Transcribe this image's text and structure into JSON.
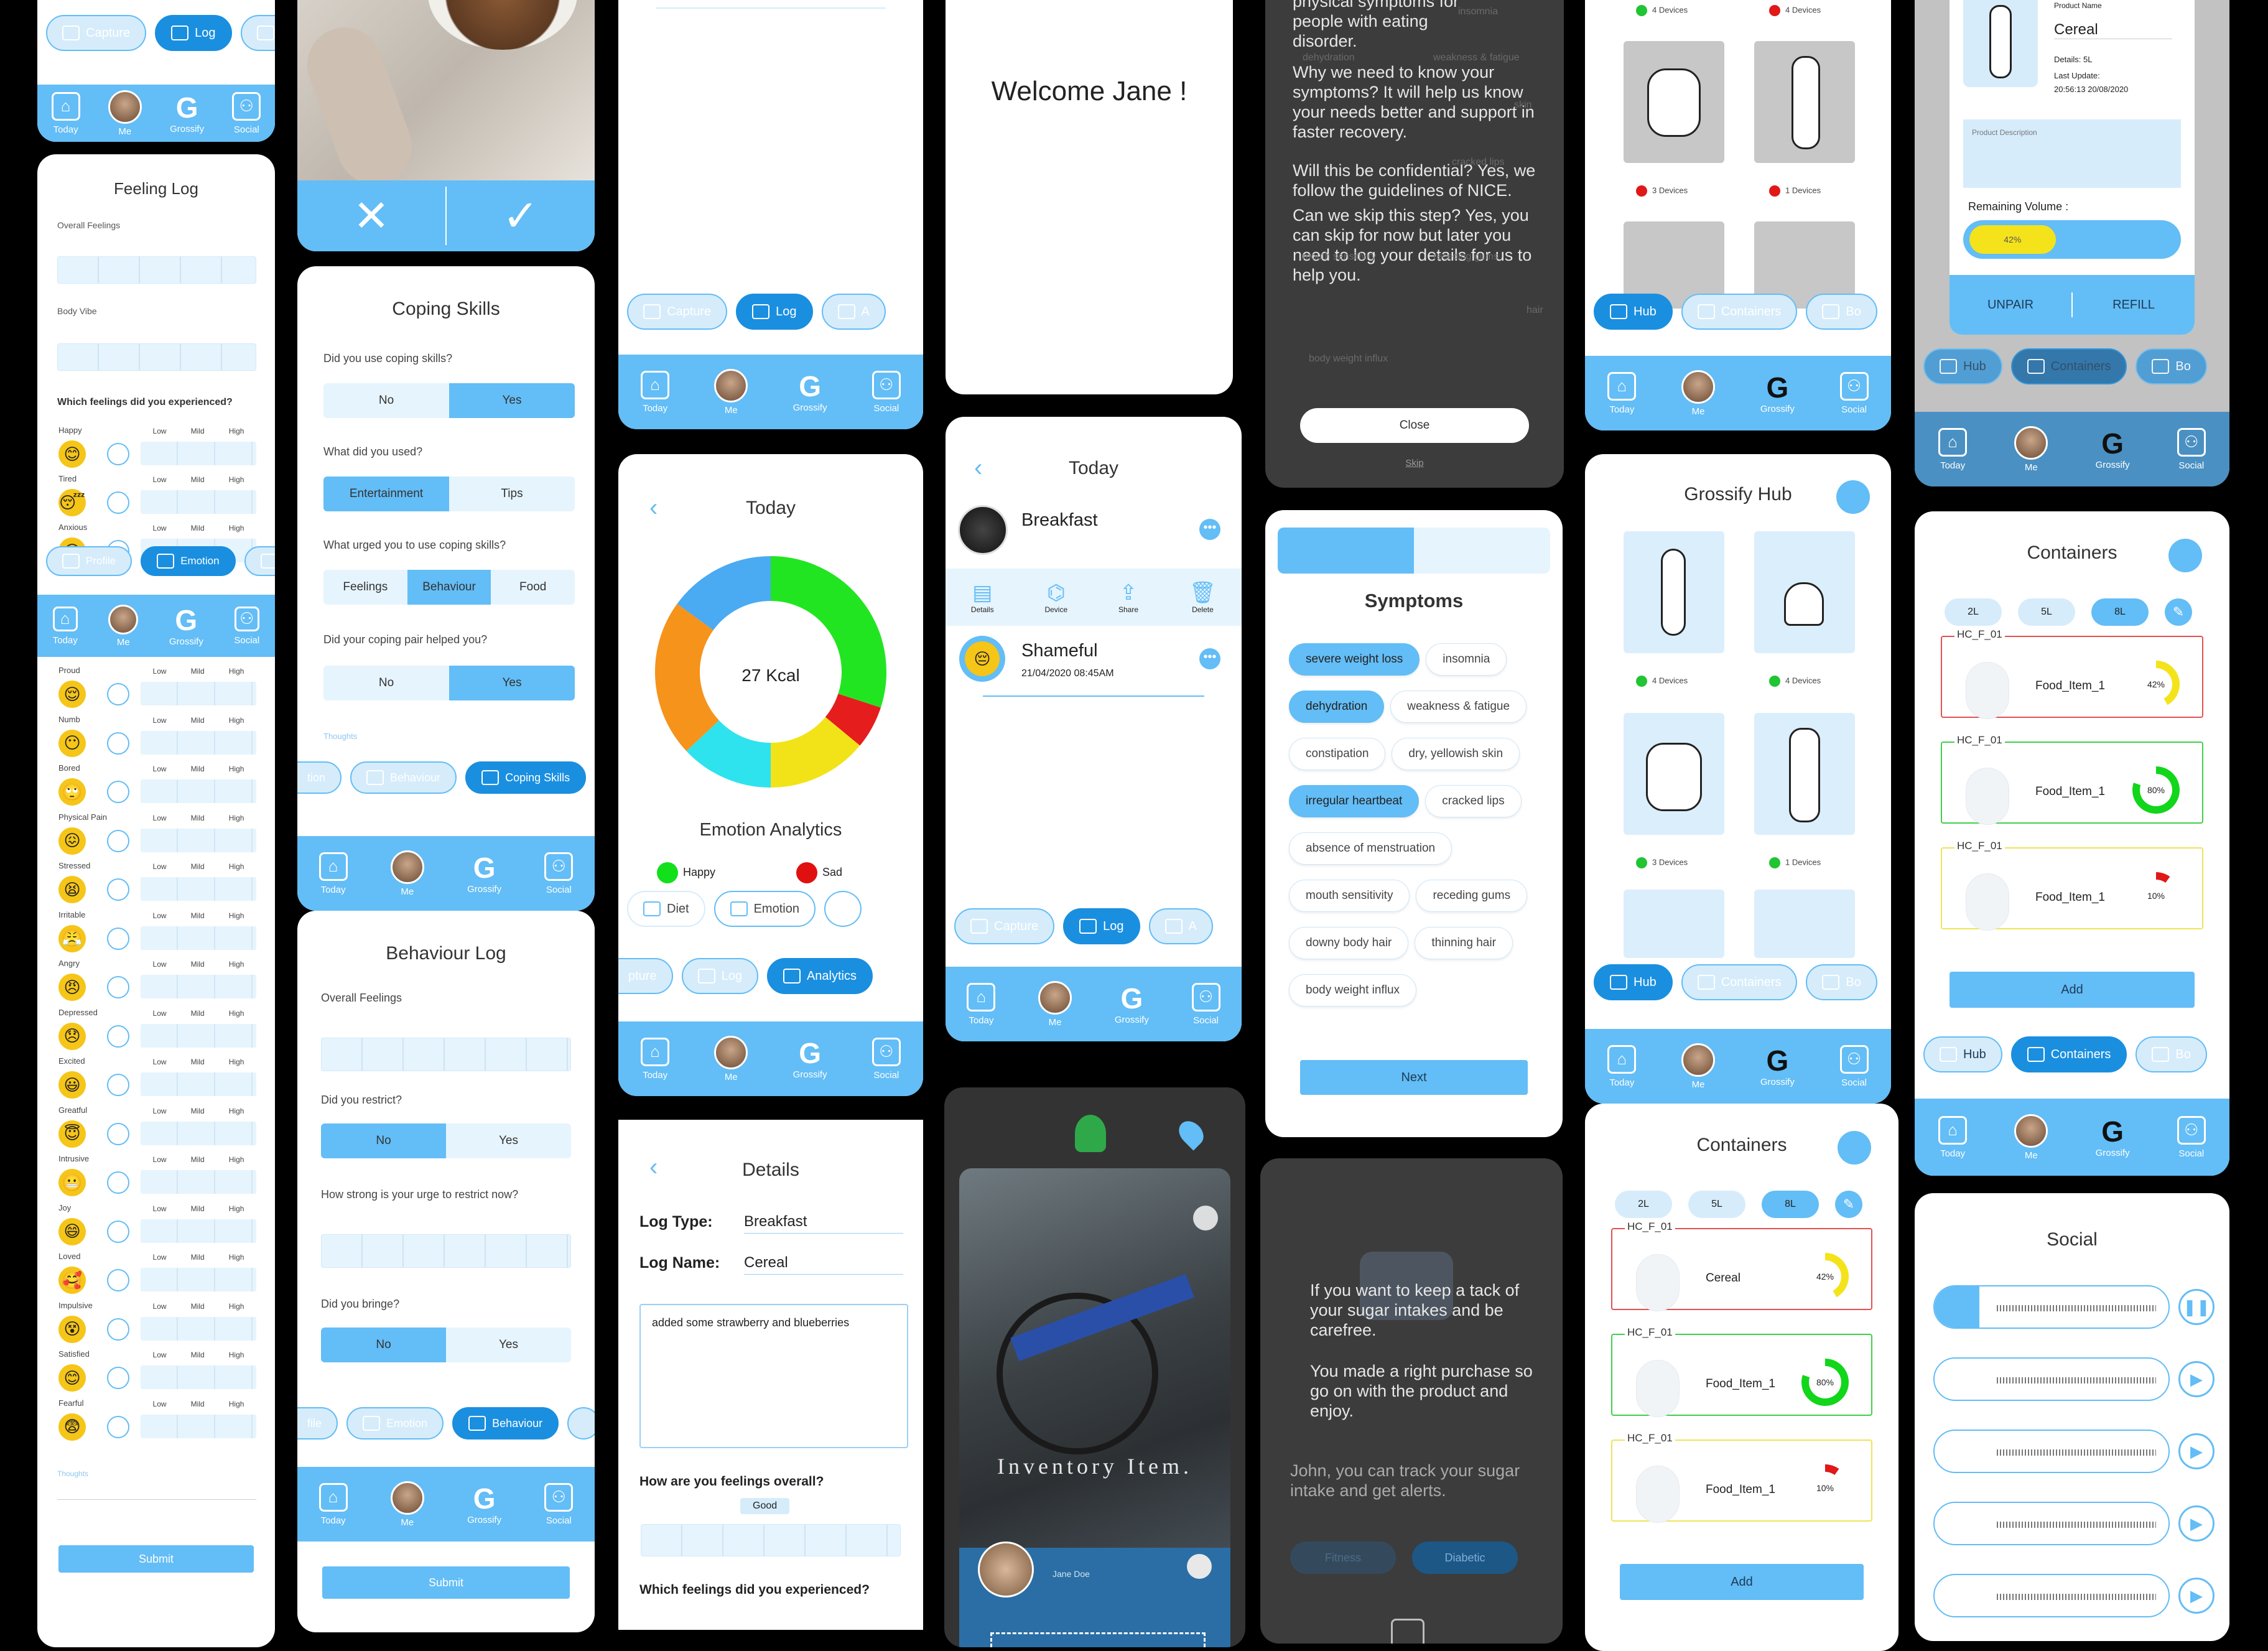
{
  "nav": {
    "today": "Today",
    "me": "Me",
    "grossify": "Grossify",
    "social": "Social",
    "g": "G"
  },
  "pills": {
    "capture": "Capture",
    "log": "Log",
    "a_cut": "A",
    "profile": "Profile",
    "emotion": "Emotion",
    "be_cut": "Be",
    "tion_cut": "tion",
    "behaviour": "Behaviour",
    "coping": "Coping Skills",
    "diet": "Diet",
    "pture_cut": "pture",
    "analytics": "Analytics",
    "hub": "Hub",
    "containers": "Containers",
    "bo_cut": "Bo",
    "file_cut": "file",
    "fitness": "Fitness",
    "diabetic": "Diabetic"
  },
  "feeling_log": {
    "title": "Feeling Log",
    "overall": "Overall Feelings",
    "body_vibe": "Body Vibe",
    "question": "Which feelings did you experienced?",
    "levels": [
      "Low",
      "Mild",
      "High"
    ],
    "top_items": [
      {
        "name": "Happy",
        "emoji": "😊"
      },
      {
        "name": "Tired",
        "emoji": "😴"
      },
      {
        "name": "Anxious",
        "emoji": "😟"
      }
    ],
    "items": [
      {
        "name": "Proud",
        "emoji": "😌"
      },
      {
        "name": "Numb",
        "emoji": "😶"
      },
      {
        "name": "Bored",
        "emoji": "🙄"
      },
      {
        "name": "Physical Pain",
        "emoji": "😖"
      },
      {
        "name": "Stressed",
        "emoji": "😫"
      },
      {
        "name": "Irritable",
        "emoji": "😤"
      },
      {
        "name": "Angry",
        "emoji": "😠"
      },
      {
        "name": "Depressed",
        "emoji": "😞"
      },
      {
        "name": "Excited",
        "emoji": "😃"
      },
      {
        "name": "Greatful",
        "emoji": "😇"
      },
      {
        "name": "Intrusive",
        "emoji": "😬"
      },
      {
        "name": "Joy",
        "emoji": "😄"
      },
      {
        "name": "Loved",
        "emoji": "🥰"
      },
      {
        "name": "Impulsive",
        "emoji": "😵"
      },
      {
        "name": "Satisfied",
        "emoji": "😊"
      },
      {
        "name": "Fearful",
        "emoji": "😨"
      }
    ],
    "thoughts": "Thoughts",
    "submit": "Submit"
  },
  "coping": {
    "title": "Coping Skills",
    "q1": "Did you use coping skills?",
    "no": "No",
    "yes": "Yes",
    "q2": "What did you used?",
    "entertainment": "Entertainment",
    "tips": "Tips",
    "q3": "What urged you to use coping skills?",
    "feelings": "Feelings",
    "behaviour": "Behaviour",
    "food": "Food",
    "q4": "Did your coping pair helped you?",
    "thoughts": "Thoughts"
  },
  "behaviour_log": {
    "title": "Behaviour Log",
    "overall": "Overall Feelings",
    "q1": "Did you restrict?",
    "q2": "How strong is your urge to restrict now?",
    "q3": "Did you bringe?",
    "no": "No",
    "yes": "Yes",
    "submit": "Submit"
  },
  "analytics": {
    "title": "Today",
    "kcal": "27 Kcal",
    "heading": "Emotion Analytics",
    "legend": [
      {
        "name": "Happy",
        "color": "#11e01b"
      },
      {
        "name": "Sad",
        "color": "#e01010"
      }
    ],
    "donut": [
      {
        "color": "#22e522",
        "value": 30
      },
      {
        "color": "#e61d1d",
        "value": 6
      },
      {
        "color": "#f2e318",
        "value": 14
      },
      {
        "color": "#2fe3ee",
        "value": 13
      },
      {
        "color": "#f6931b",
        "value": 22
      },
      {
        "color": "#4aaaf2",
        "value": 15
      }
    ]
  },
  "details": {
    "title": "Details",
    "log_type_label": "Log Type:",
    "log_type": "Breakfast",
    "log_name_label": "Log Name:",
    "log_name": "Cereal",
    "notes": "added some strawberry and blueberries",
    "q1": "How are you feelings overall?",
    "good": "Good",
    "q2": "Which feelings did you experienced?"
  },
  "welcome": {
    "text": "Welcome Jane !"
  },
  "today_log": {
    "title": "Today",
    "entry1": "Breakfast",
    "actions": [
      "Details",
      "Device",
      "Share",
      "Delete"
    ],
    "entry2": "Shameful",
    "entry2_date": "21/04/2020 08:45AM"
  },
  "camera": {
    "overlay": "Inventory Item.",
    "user": "Jane Doe"
  },
  "info": {
    "p1a": "physical symptoms for",
    "p1b": "people with eating",
    "p1c": "disorder.",
    "p2": "Why we need to know your symptoms? It will help us know your needs better and support in faster recovery.",
    "p3": "Will this be confidential? Yes, we follow the guidelines of NICE.",
    "p4": "Can we skip this step? Yes, you can skip for now but later you need to log your details for us to help you.",
    "close": "Close",
    "skip": "Skip",
    "faint": [
      "insomnia",
      "dehydration",
      "weakness & fatigue",
      "skin",
      "cracked lips",
      "mouth sensitivity",
      "receding gums",
      "hair",
      "body weight influx"
    ]
  },
  "symptoms": {
    "title": "Symptoms",
    "chips": [
      {
        "t": "severe weight loss",
        "on": true
      },
      {
        "t": "insomnia",
        "on": false
      },
      {
        "t": "dehydration",
        "on": true
      },
      {
        "t": "weakness & fatigue",
        "on": false
      },
      {
        "t": "constipation",
        "on": false
      },
      {
        "t": "dry, yellowish skin",
        "on": false
      },
      {
        "t": "irregular heartbeat",
        "on": true
      },
      {
        "t": "cracked lips",
        "on": false
      },
      {
        "t": "absence of menstruation",
        "on": false
      },
      {
        "t": "mouth sensitivity",
        "on": false
      },
      {
        "t": "receding gums",
        "on": false
      },
      {
        "t": "downy body hair",
        "on": false
      },
      {
        "t": "thinning  hair",
        "on": false
      },
      {
        "t": "body weight influx",
        "on": false
      }
    ],
    "next": "Next",
    "progress": 0.5
  },
  "sugar": {
    "p1": "If you want to keep a tack of your sugar intakes and be carefree.",
    "p2": "You made a right purchase so go on with the product and enjoy.",
    "p3": "John, you can track your sugar intake and get alerts."
  },
  "hub": {
    "title": "Grossify Hub",
    "counts": [
      "4 Devices",
      "4 Devices",
      "3 Devices",
      "1 Devices"
    ],
    "top_counts": [
      "4 Devices",
      "4 Devices",
      "3 Devices",
      "1 Devices"
    ]
  },
  "containers": {
    "title": "Containers",
    "sizes": [
      "2L",
      "5L",
      "8L"
    ],
    "cards_a": [
      {
        "id": "HC_F_01",
        "name": "Cereal",
        "pct": 42,
        "color": "#f4e31b",
        "border": "#e45050"
      },
      {
        "id": "HC_F_01",
        "name": "Food_Item_1",
        "pct": 80,
        "color": "#11d61a",
        "border": "#3fcf4b"
      },
      {
        "id": "HC_F_01",
        "name": "Food_Item_1",
        "pct": 10,
        "color": "#e01818",
        "border": "#efe35a"
      }
    ],
    "cards_b": [
      {
        "id": "HC_F_01",
        "name": "Food_Item_1",
        "pct": 42,
        "color": "#f4e31b",
        "border": "#e45050"
      },
      {
        "id": "HC_F_01",
        "name": "Food_Item_1",
        "pct": 80,
        "color": "#11d61a",
        "border": "#3fcf4b"
      },
      {
        "id": "HC_F_01",
        "name": "Food_Item_1",
        "pct": 10,
        "color": "#e01818",
        "border": "#efe35a"
      }
    ],
    "add": "Add"
  },
  "product": {
    "name_label": "Product Name",
    "name": "Cereal",
    "details": "Details: 5L",
    "last_update_label": "Last Update:",
    "last_update": "20:56:13  20/08/2020",
    "desc": "Product Description",
    "remaining": "Remaining Volume :",
    "pct": "42%",
    "remaining_fraction": 0.42,
    "unpair": "UNPAIR",
    "refill": "REFILL"
  },
  "social": {
    "title": "Social"
  }
}
